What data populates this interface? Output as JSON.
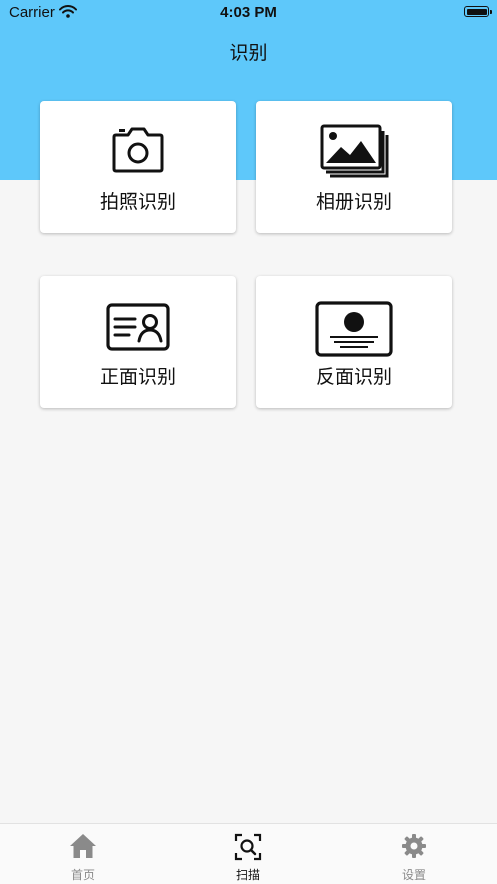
{
  "status_bar": {
    "carrier": "Carrier",
    "time": "4:03 PM"
  },
  "header": {
    "title": "识别"
  },
  "cards": [
    {
      "label": "拍照识别",
      "icon": "camera-icon"
    },
    {
      "label": "相册识别",
      "icon": "photo-album-icon"
    },
    {
      "label": "正面识别",
      "icon": "id-card-front-icon"
    },
    {
      "label": "反面识别",
      "icon": "id-card-back-icon"
    }
  ],
  "tab_bar": {
    "items": [
      {
        "label": "首页",
        "icon": "home-icon",
        "active": false
      },
      {
        "label": "扫描",
        "icon": "scan-icon",
        "active": true
      },
      {
        "label": "设置",
        "icon": "gear-icon",
        "active": false
      }
    ]
  },
  "colors": {
    "header_bg": "#5ec8fa",
    "page_bg": "#f6f6f6",
    "tab_inactive": "#8a8a8a",
    "tab_active": "#111111"
  }
}
